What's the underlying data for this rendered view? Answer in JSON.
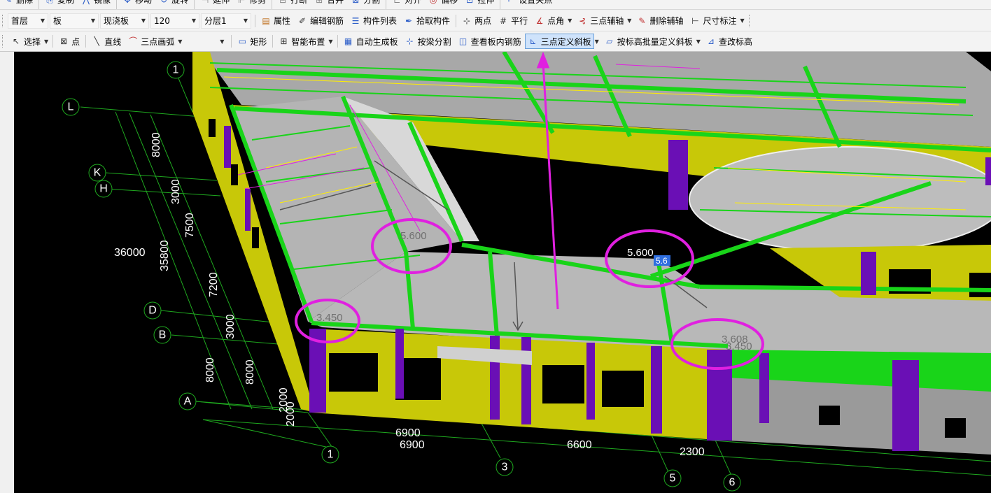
{
  "toolbar_top": [
    "删除",
    "复制",
    "镜像",
    "移动",
    "旋转",
    "延伸",
    "修剪",
    "打断",
    "合并",
    "分割",
    "对齐",
    "偏移",
    "拉伸",
    "设置夹点"
  ],
  "toolbar1": {
    "floor": "首层",
    "component_type": "板",
    "component_subtype": "现浇板",
    "component_name": "120",
    "sublayer": "分层1",
    "buttons": [
      "属性",
      "编辑钢筋",
      "构件列表",
      "拾取构件",
      "两点",
      "平行",
      "点角",
      "三点辅轴",
      "删除辅轴",
      "尺寸标注"
    ]
  },
  "toolbar2": {
    "select": "选择",
    "point": "点",
    "line": "直线",
    "arc": "三点画弧",
    "arc_value": "",
    "buttons": [
      "矩形",
      "智能布置",
      "自动生成板",
      "按梁分割",
      "查看板内钢筋",
      "三点定义斜板",
      "按标高批量定义斜板",
      "查改标高"
    ]
  },
  "scene": {
    "axis_letters": [
      "L",
      "K",
      "H",
      "D",
      "B",
      "A"
    ],
    "axis_numbers_top": [
      "1"
    ],
    "axis_numbers_bottom": [
      "1",
      "3",
      "5",
      "6"
    ],
    "dims_left_outer": [
      "36000"
    ],
    "dims_left_mid": [
      "35800"
    ],
    "dims_left_inner": [
      "8000",
      "3000",
      "7500",
      "7200",
      "3000",
      "8000"
    ],
    "dims_left_second": [
      "8000"
    ],
    "dims_left_small": [
      "2000",
      "2000"
    ],
    "dims_bottom_row1": [
      "6900"
    ],
    "dims_bottom_row2": [
      "6900",
      "6600",
      "2300"
    ],
    "elevations": [
      "5.600",
      "5.600",
      "3.450",
      "3.608",
      "3.450"
    ],
    "elevation_input": "5.6"
  },
  "colors": {
    "beam": "#19d419",
    "wall": "#c8c808",
    "column": "#6a0fb5",
    "slab": "#b4b4b4",
    "highlight": "#e020e0",
    "axis": "#1fa81f"
  }
}
